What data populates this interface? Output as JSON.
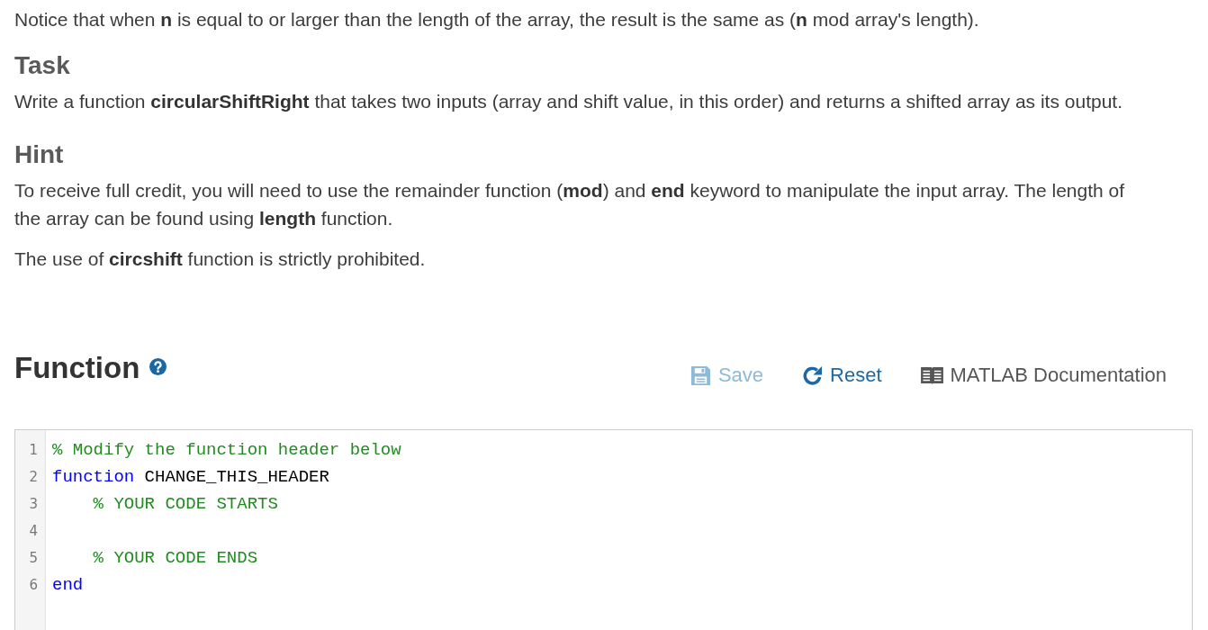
{
  "description": {
    "paragraphs": [
      "Notice that when **n** is equal to or larger than the length of the array, the result is the same as (**n** mod array's length)."
    ]
  },
  "sections": [
    {
      "heading": "Task",
      "paragraphs": [
        "Write a function **circularShiftRight** that takes two inputs (array and shift value, in this order) and returns a shifted array as its output."
      ]
    },
    {
      "heading": "Hint",
      "paragraphs": [
        "To receive full credit, you will need to use the remainder function (**mod**) and **end** keyword to manipulate the input array. The length of the array can be found using **length** function.",
        "The use of **circshift** function is strictly prohibited."
      ]
    }
  ],
  "function_panel": {
    "title": "Function",
    "toolbar": [
      {
        "kind": "save",
        "label": "Save",
        "disabled": true
      },
      {
        "kind": "reset",
        "label": "Reset",
        "disabled": false
      },
      {
        "kind": "documentation",
        "label": "MATLAB Documentation"
      }
    ],
    "editor": {
      "lines": [
        {
          "number": "1",
          "tokens": [
            {
              "kind": "comment",
              "text": "% Modify the function header below"
            }
          ]
        },
        {
          "number": "2",
          "tokens": [
            {
              "kind": "keyword",
              "text": "function"
            },
            {
              "kind": "plain",
              "text": " CHANGE_THIS_HEADER"
            }
          ]
        },
        {
          "number": "3",
          "tokens": [
            {
              "kind": "comment",
              "text": "    % YOUR CODE STARTS"
            }
          ]
        },
        {
          "number": "4"
        },
        {
          "number": "5",
          "tokens": [
            {
              "kind": "comment",
              "text": "    % YOUR CODE ENDS"
            }
          ]
        },
        {
          "number": "6",
          "tokens": [
            {
              "kind": "keyword",
              "text": "end"
            }
          ]
        }
      ]
    }
  }
}
